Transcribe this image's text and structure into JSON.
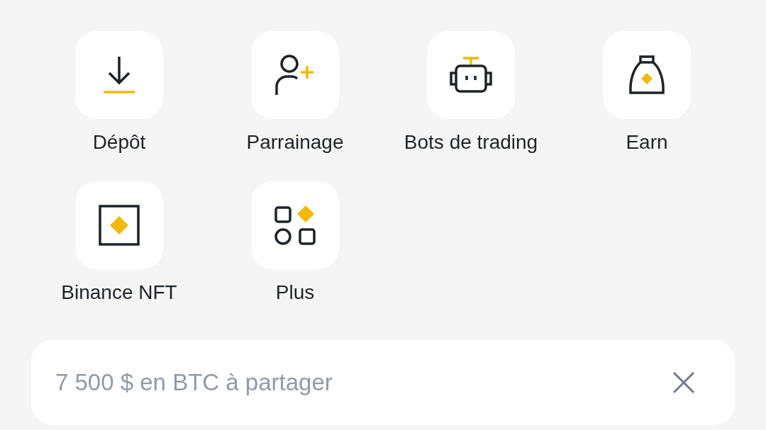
{
  "shortcuts": [
    {
      "label": "Dépôt",
      "kind": "deposit"
    },
    {
      "label": "Parrainage",
      "kind": "referral"
    },
    {
      "label": "Bots de trading",
      "kind": "bot"
    },
    {
      "label": "Earn",
      "kind": "earn"
    },
    {
      "label": "Binance NFT",
      "kind": "nft"
    },
    {
      "label": "Plus",
      "kind": "more"
    }
  ],
  "promo": {
    "title": "7 500 $ en BTC à partager"
  }
}
